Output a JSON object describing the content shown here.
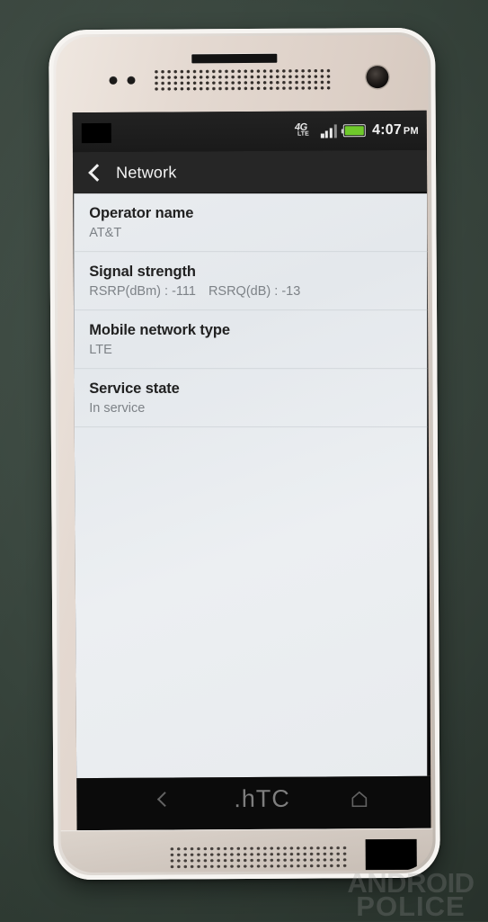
{
  "scene": {
    "description": "Photo of a white HTC One mini smartphone displaying the Android Network settings screen",
    "background_color": "#3a473f"
  },
  "watermark": {
    "line1": "ANDROID",
    "line2": "POLICE"
  },
  "device": {
    "brand_logo": "hTC",
    "body_color": "#dcd4cc",
    "hardware": {
      "earpiece_slot": "earpiece-slot",
      "speaker_grille_top": "speaker-grille",
      "speaker_grille_bottom": "speaker-grille",
      "front_camera": "camera-icon",
      "proximity_sensors": "sensor-dots"
    },
    "capacitive_keys": {
      "back": "back-icon",
      "home": "home-icon"
    },
    "redactions": [
      {
        "name": "status-bar-redaction"
      },
      {
        "name": "chin-redaction"
      }
    ]
  },
  "statusbar": {
    "network_type_main": "4G",
    "network_type_sub": "LTE",
    "signal_bars_total": 4,
    "signal_bars_filled": 3,
    "battery_level_percent": 85,
    "battery_color": "#6fc92b",
    "time": "4:07",
    "time_period": "PM"
  },
  "actionbar": {
    "back_icon": "back-chevron-icon",
    "title": "Network"
  },
  "list": {
    "rows": [
      {
        "label": "Operator name",
        "value": "AT&T",
        "value_segments": [
          "AT&T"
        ]
      },
      {
        "label": "Signal strength",
        "value": "RSRP(dBm) : -111  RSRQ(dB) : -13",
        "value_segments": [
          "RSRP(dBm) : -111",
          "RSRQ(dB) : -13"
        ]
      },
      {
        "label": "Mobile network type",
        "value": "LTE",
        "value_segments": [
          "LTE"
        ]
      },
      {
        "label": "Service state",
        "value": "In service",
        "value_segments": [
          "In service"
        ]
      }
    ]
  },
  "colors": {
    "panel_background": "#eceff2",
    "label_text": "#212121",
    "value_text": "#7d8287",
    "divider": "#d2d7dc",
    "statusbar_bg": "#1d1d1d",
    "actionbar_bg": "#262626",
    "screen_black": "#0b0b0b"
  }
}
